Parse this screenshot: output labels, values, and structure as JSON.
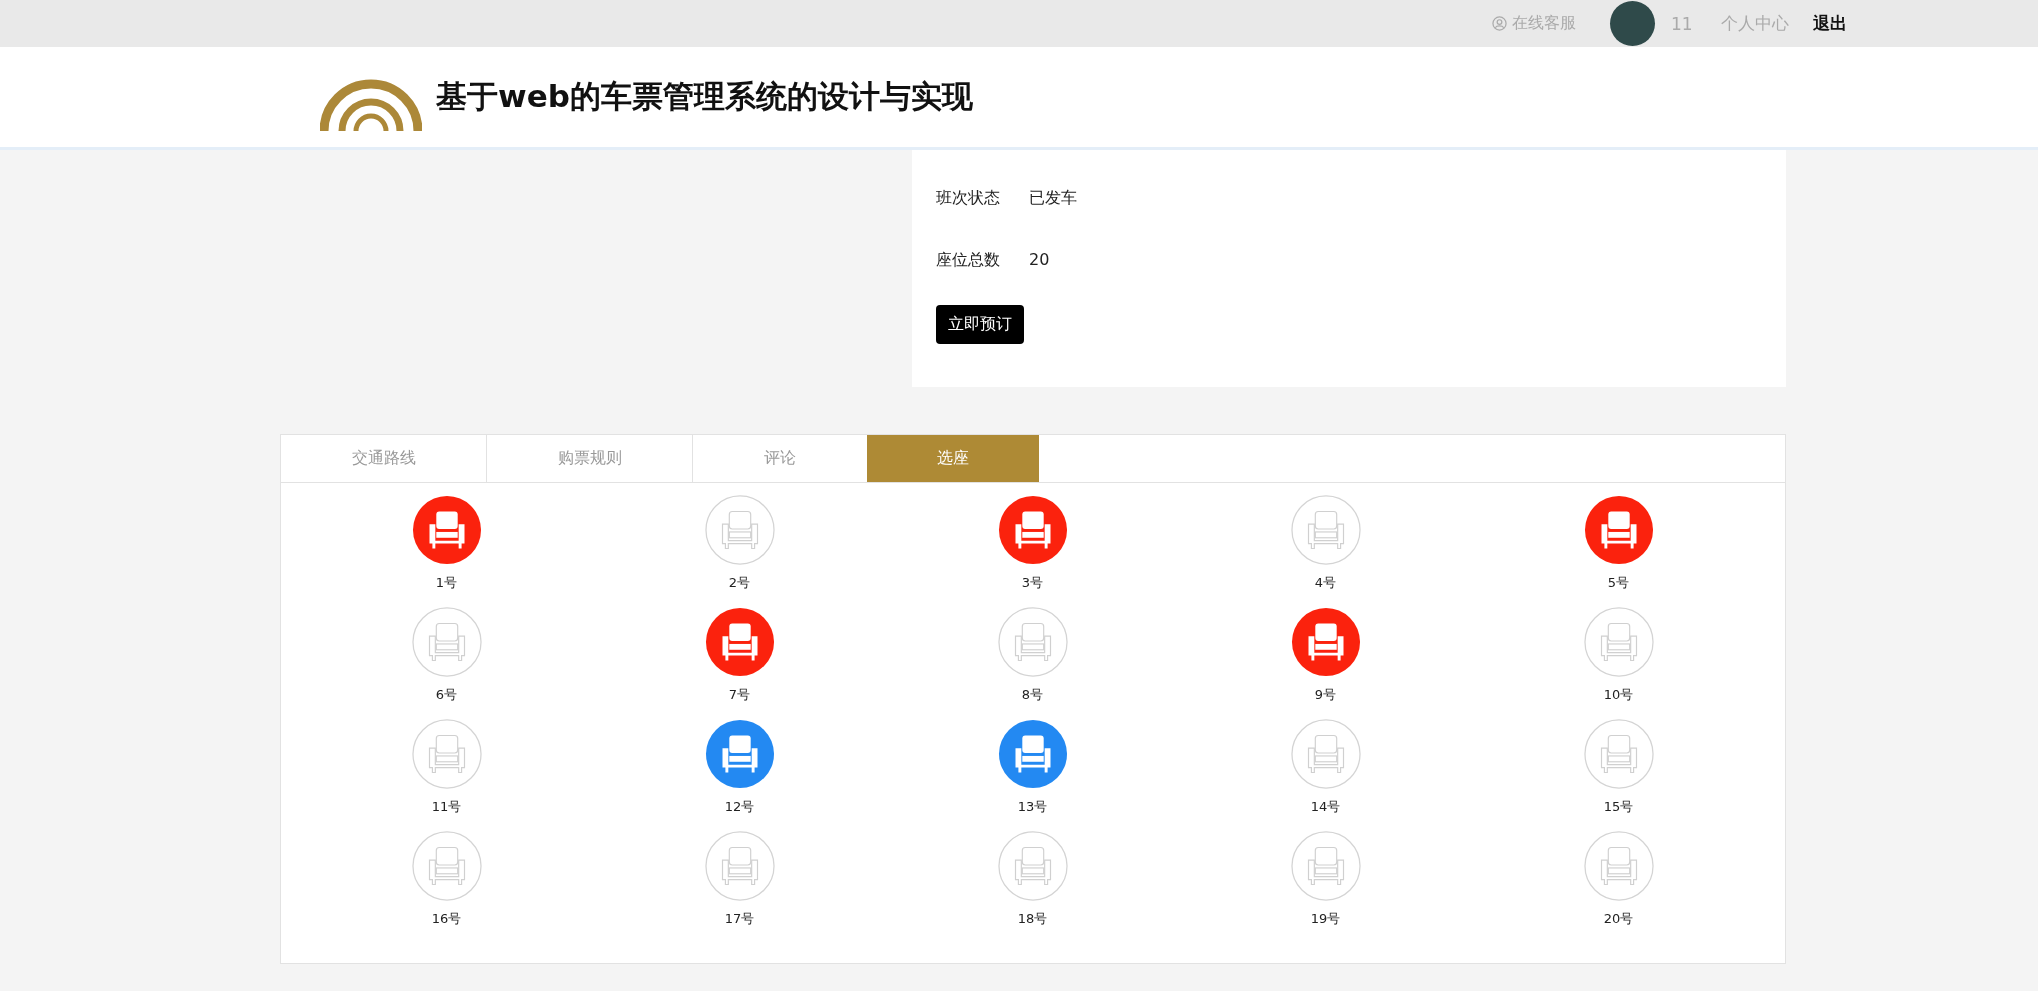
{
  "top_bar": {
    "service_link": "在线客服",
    "username": "11",
    "profile_link": "个人中心",
    "logout_link": "退出"
  },
  "header": {
    "title": "基于web的车票管理系统的设计与实现"
  },
  "info": {
    "fields": [
      {
        "label": "班次状态",
        "value": "已发车"
      },
      {
        "label": "座位总数",
        "value": "20"
      }
    ],
    "book_button": "立即预订"
  },
  "tabs": [
    {
      "label": "交通路线",
      "selected": false
    },
    {
      "label": "购票规则",
      "selected": false
    },
    {
      "label": "评论",
      "selected": false
    },
    {
      "label": "选座",
      "selected": true
    }
  ],
  "seats": [
    {
      "label": "1号",
      "sold": true,
      "selected": false
    },
    {
      "label": "2号",
      "sold": false,
      "selected": false
    },
    {
      "label": "3号",
      "sold": true,
      "selected": false
    },
    {
      "label": "4号",
      "sold": false,
      "selected": false
    },
    {
      "label": "5号",
      "sold": true,
      "selected": false
    },
    {
      "label": "6号",
      "sold": false,
      "selected": false
    },
    {
      "label": "7号",
      "sold": true,
      "selected": false
    },
    {
      "label": "8号",
      "sold": false,
      "selected": false
    },
    {
      "label": "9号",
      "sold": true,
      "selected": false
    },
    {
      "label": "10号",
      "sold": false,
      "selected": false
    },
    {
      "label": "11号",
      "sold": false,
      "selected": false
    },
    {
      "label": "12号",
      "sold": false,
      "selected": true
    },
    {
      "label": "13号",
      "sold": false,
      "selected": true
    },
    {
      "label": "14号",
      "sold": false,
      "selected": false
    },
    {
      "label": "15号",
      "sold": false,
      "selected": false
    },
    {
      "label": "16号",
      "sold": false,
      "selected": false
    },
    {
      "label": "17号",
      "sold": false,
      "selected": false
    },
    {
      "label": "18号",
      "sold": false,
      "selected": false
    },
    {
      "label": "19号",
      "sold": false,
      "selected": false
    },
    {
      "label": "20号",
      "sold": false,
      "selected": false
    }
  ]
}
